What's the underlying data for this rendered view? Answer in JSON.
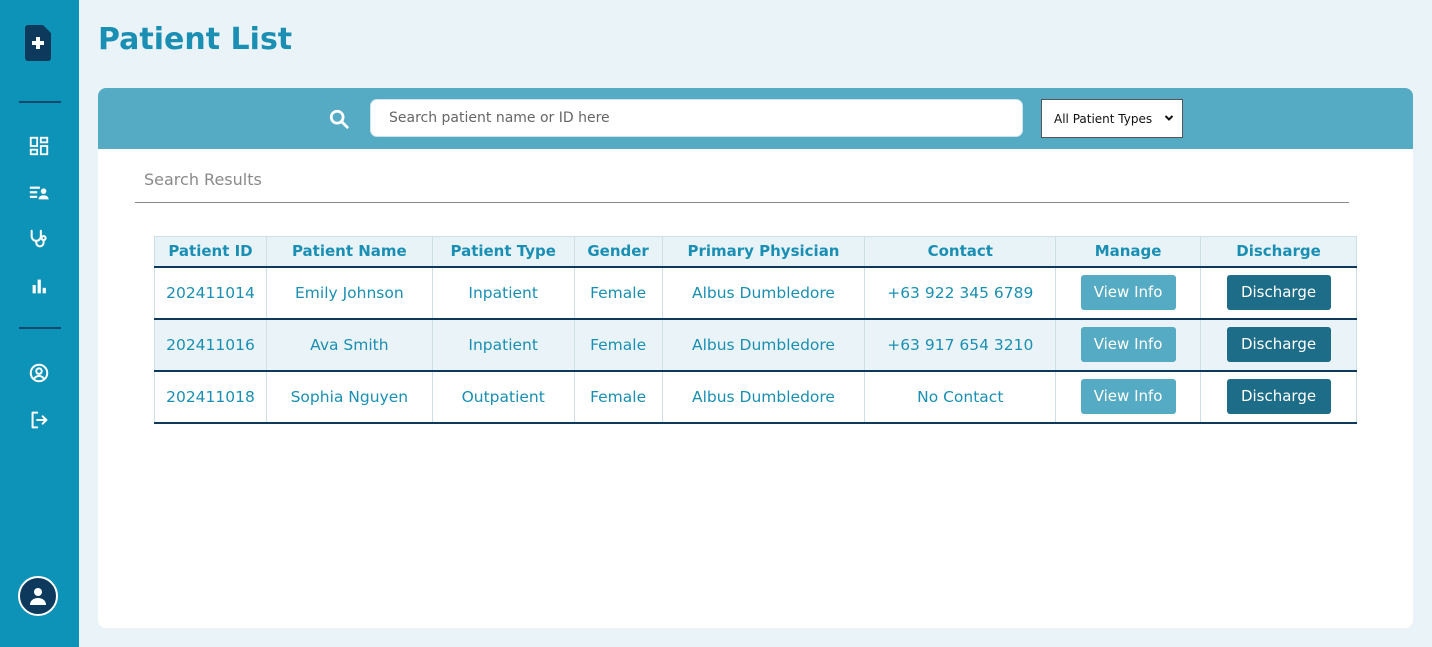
{
  "sidebar": {
    "logo_icon": "medical-file-plus-icon",
    "nav_items": [
      {
        "icon": "dashboard-icon"
      },
      {
        "icon": "patient-list-icon"
      },
      {
        "icon": "stethoscope-icon"
      },
      {
        "icon": "bar-chart-icon"
      }
    ],
    "account_items": [
      {
        "icon": "user-circle-icon"
      },
      {
        "icon": "logout-icon"
      }
    ],
    "avatar_icon": "user-avatar-icon"
  },
  "header": {
    "title": "Patient List"
  },
  "search": {
    "placeholder": "Search patient name or ID here",
    "value": "",
    "type_filter": "All Patient Types"
  },
  "results": {
    "label": "Search Results"
  },
  "table": {
    "columns": [
      "Patient ID",
      "Patient Name",
      "Patient Type",
      "Gender",
      "Primary Physician",
      "Contact",
      "Manage",
      "Discharge"
    ],
    "rows": [
      {
        "id": "202411014",
        "name": "Emily Johnson",
        "type": "Inpatient",
        "gender": "Female",
        "physician": "Albus Dumbledore",
        "contact": "+63 922 345 6789",
        "manage": "View Info",
        "discharge": "Discharge"
      },
      {
        "id": "202411016",
        "name": "Ava Smith",
        "type": "Inpatient",
        "gender": "Female",
        "physician": "Albus Dumbledore",
        "contact": "+63 917 654 3210",
        "manage": "View Info",
        "discharge": "Discharge"
      },
      {
        "id": "202411018",
        "name": "Sophia Nguyen",
        "type": "Outpatient",
        "gender": "Female",
        "physician": "Albus Dumbledore",
        "contact": "No Contact",
        "manage": "View Info",
        "discharge": "Discharge"
      }
    ]
  },
  "colors": {
    "sidebar": "#0e93b8",
    "accent": "#1a8fb3",
    "navy": "#0d3a5c",
    "search_bar": "#56abc4",
    "discharge_button": "#1d6c88"
  }
}
